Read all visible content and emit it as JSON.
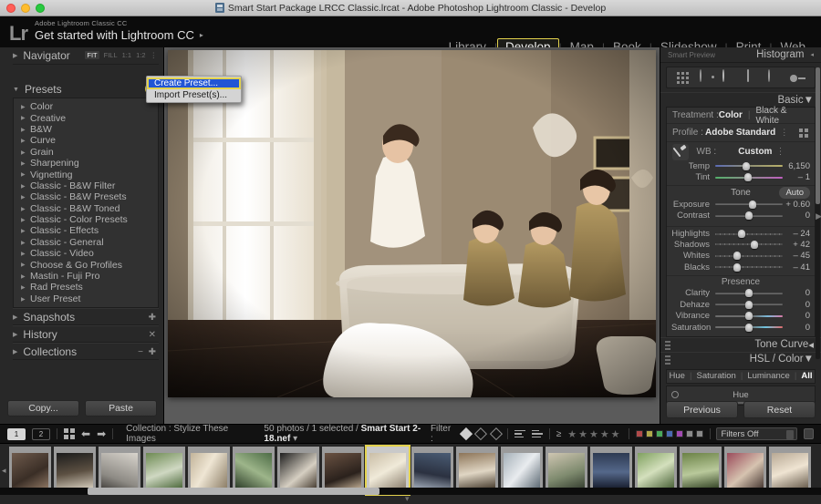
{
  "window": {
    "title": "Smart Start Package LRCC Classic.lrcat - Adobe Photoshop Lightroom Classic - Develop",
    "doc_icon": "catalog-icon"
  },
  "identity": {
    "logo": "Lr",
    "sub_label": "Adobe Lightroom Classic CC",
    "main_label": "Get started with Lightroom CC",
    "arrow": "▸"
  },
  "modules": {
    "items": [
      {
        "label": "Library",
        "active": false
      },
      {
        "label": "Develop",
        "active": true
      },
      {
        "label": "Map",
        "active": false
      },
      {
        "label": "Book",
        "active": false
      },
      {
        "label": "Slideshow",
        "active": false
      },
      {
        "label": "Print",
        "active": false
      },
      {
        "label": "Web",
        "active": false
      }
    ],
    "separator": "|"
  },
  "left_panel": {
    "navigator": {
      "title": "Navigator",
      "zoom_levels": [
        "FIT",
        "FILL",
        "1:1",
        "1:2"
      ],
      "active_zoom": "FIT",
      "dropdown_icon": "chevron-updown-icon"
    },
    "presets": {
      "title": "Presets",
      "add_icon": "plus-icon",
      "items": [
        "Color",
        "Creative",
        "B&W",
        "Curve",
        "Grain",
        "Sharpening",
        "Vignetting",
        "Classic - B&W Filter",
        "Classic - B&W Presets",
        "Classic - B&W Toned",
        "Classic - Color Presets",
        "Classic - Effects",
        "Classic - General",
        "Classic - Video",
        "Choose & Go Profiles",
        "Mastin - Fuji Pro",
        "Rad Presets",
        "User Preset"
      ]
    },
    "snapshots": {
      "title": "Snapshots",
      "icon": "plus-icon"
    },
    "history": {
      "title": "History",
      "icon": "close-icon"
    },
    "collections": {
      "title": "Collections",
      "icon_minus": "minus-icon",
      "icon_plus": "plus-icon"
    },
    "buttons": {
      "copy": "Copy...",
      "paste": "Paste"
    }
  },
  "context_menu": {
    "items": [
      {
        "label": "Create Preset...",
        "selected": true
      },
      {
        "label": "Import Preset(s)...",
        "selected": false
      }
    ],
    "highlight_color": "#2255d4",
    "focus_color": "#e3d24d"
  },
  "right_panel": {
    "header": {
      "smart_preview": "Smart Preview",
      "title": "Histogram",
      "collapse": "◂"
    },
    "tools": [
      "crop-overlay-icon",
      "spot-removal-icon",
      "red-eye-icon",
      "graduated-filter-icon",
      "radial-filter-icon",
      "adjustment-brush-icon"
    ],
    "basic": {
      "title": "Basic",
      "treatment": {
        "label": "Treatment :",
        "option_color": "Color",
        "option_bw": "Black & White",
        "selected": "Color"
      },
      "profile": {
        "label": "Profile :",
        "value": "Adobe Standard",
        "browse_icon": "profile-browser-icon"
      },
      "wb": {
        "label": "WB :",
        "value": "Custom",
        "eyedropper": "eyedropper-icon"
      },
      "wb_sliders": [
        {
          "name": "Temp",
          "value": "6,150",
          "pos": 46,
          "style": "temp"
        },
        {
          "name": "Tint",
          "value": "– 1",
          "pos": 49,
          "style": "tint"
        }
      ],
      "tone": {
        "label": "Tone",
        "auto": "Auto"
      },
      "tone_sliders": [
        {
          "name": "Exposure",
          "value": "+ 0.60",
          "pos": 56,
          "style": "plain"
        },
        {
          "name": "Contrast",
          "value": "0",
          "pos": 50,
          "style": "plain"
        }
      ],
      "tone_sliders2": [
        {
          "name": "Highlights",
          "value": "– 24",
          "pos": 39,
          "style": "ticks"
        },
        {
          "name": "Shadows",
          "value": "+ 42",
          "pos": 58,
          "style": "ticks"
        },
        {
          "name": "Whites",
          "value": "– 45",
          "pos": 32,
          "style": "ticks"
        },
        {
          "name": "Blacks",
          "value": "– 41",
          "pos": 33,
          "style": "ticks"
        }
      ],
      "presence": {
        "label": "Presence"
      },
      "presence_sliders": [
        {
          "name": "Clarity",
          "value": "0",
          "pos": 50,
          "style": "plain"
        },
        {
          "name": "Dehaze",
          "value": "0",
          "pos": 50,
          "style": "plain"
        },
        {
          "name": "Vibrance",
          "value": "0",
          "pos": 50,
          "style": "vib"
        },
        {
          "name": "Saturation",
          "value": "0",
          "pos": 50,
          "style": "sat"
        }
      ]
    },
    "tone_curve": {
      "title": "Tone Curve",
      "collapse": "◂"
    },
    "hsl": {
      "title": "HSL / Color",
      "expand": "▼",
      "tabs": [
        "Hue",
        "Saturation",
        "Luminance",
        "All"
      ],
      "active_tab": "All",
      "sub_label": "Hue"
    },
    "buttons": {
      "previous": "Previous",
      "reset": "Reset"
    }
  },
  "filmstrip_toolbar": {
    "page_buttons": [
      "1",
      "2"
    ],
    "grid_icon": "grid-view-icon",
    "back_icon": "arrow-left-icon",
    "forward_icon": "arrow-right-icon",
    "source": "Collection : Stylize These Images",
    "status": "50 photos / 1 selected /",
    "filename": "Smart Start 2-18.nef",
    "filename_caret": "▾",
    "filter_label": "Filter :",
    "flags": [
      "flag-pick-icon",
      "flag-unflagged-icon",
      "flag-rejected-icon"
    ],
    "sort_icons": [
      "sort-ascending-icon",
      "sort-descending-icon"
    ],
    "rating_op": "≥",
    "stars": "★★★★★",
    "color_swatches": [
      "#b04a4a",
      "#b0a84a",
      "#4aa85a",
      "#4a6ab0",
      "#a04ab0",
      "#8a8a8a",
      "#8a8a8a"
    ],
    "filters_off": "Filters Off",
    "caret_icon": "chevron-updown-icon",
    "lock_icon": "lock-icon"
  },
  "filmstrip": {
    "left_arrow": "◂",
    "bottom_arrow": "▾",
    "selected_index": 8,
    "thumbnails": [
      {
        "name": "thumb-1",
        "bg": "linear-gradient(150deg,#6e5a4c,#3a2e26 60%,#8a7360)"
      },
      {
        "name": "thumb-2",
        "bg": "linear-gradient(170deg,#1b1b1b,#5c5042 55%,#cfc6b6)"
      },
      {
        "name": "thumb-3",
        "bg": "linear-gradient(200deg,#d8d4cd,#8d8a84 70%,#4a4743)"
      },
      {
        "name": "thumb-4",
        "bg": "linear-gradient(160deg,#6d8a52,#cfd8c2 55%,#4f6b3e)"
      },
      {
        "name": "thumb-5",
        "bg": "linear-gradient(120deg,#c2b49a,#efe6d4 45%,#8d7f68)"
      },
      {
        "name": "thumb-6",
        "bg": "linear-gradient(210deg,#4c6b45,#9db58a 50%,#2f3f2a)"
      },
      {
        "name": "thumb-7",
        "bg": "linear-gradient(140deg,#1e1e1e,#d6cfc2 60%,#4a4035)"
      },
      {
        "name": "thumb-8",
        "bg": "linear-gradient(160deg,#6a5242,#2a211c 65%,#b7a headers)"
      },
      {
        "name": "thumb-9",
        "bg": "linear-gradient(150deg,#c9bda6,#f0ead9 50%,#8e8270)"
      },
      {
        "name": "thumb-10",
        "bg": "linear-gradient(190deg,#4a5c74,#2b3140 60%,#9aa4b2)"
      },
      {
        "name": "thumb-11",
        "bg": "linear-gradient(170deg,#8c7458,#e0d6c4 55%,#4e4335)"
      },
      {
        "name": "thumb-12",
        "bg": "linear-gradient(130deg,#a5b0b8,#e9ecef 50%,#5d6a74)"
      },
      {
        "name": "thumb-13",
        "bg": "linear-gradient(160deg,#cfc6b2,#7e8a6e 60%,#394233)"
      },
      {
        "name": "thumb-14",
        "bg": "linear-gradient(180deg,#2d3a52,#55688a 55%,#1b2233)"
      },
      {
        "name": "thumb-15",
        "bg": "linear-gradient(150deg,#7fa05f,#d4e0bd 50%,#4b6339)"
      },
      {
        "name": "thumb-16",
        "bg": "linear-gradient(170deg,#6b8246,#b9c99b 55%,#3a4a2b)"
      },
      {
        "name": "thumb-17",
        "bg": "linear-gradient(140deg,#9a4a5a,#d6c3b0 55%,#4a3b35)"
      },
      {
        "name": "thumb-18",
        "bg": "linear-gradient(160deg,#b7a894,#efe4d2 50%,#6b5f50)"
      }
    ]
  }
}
